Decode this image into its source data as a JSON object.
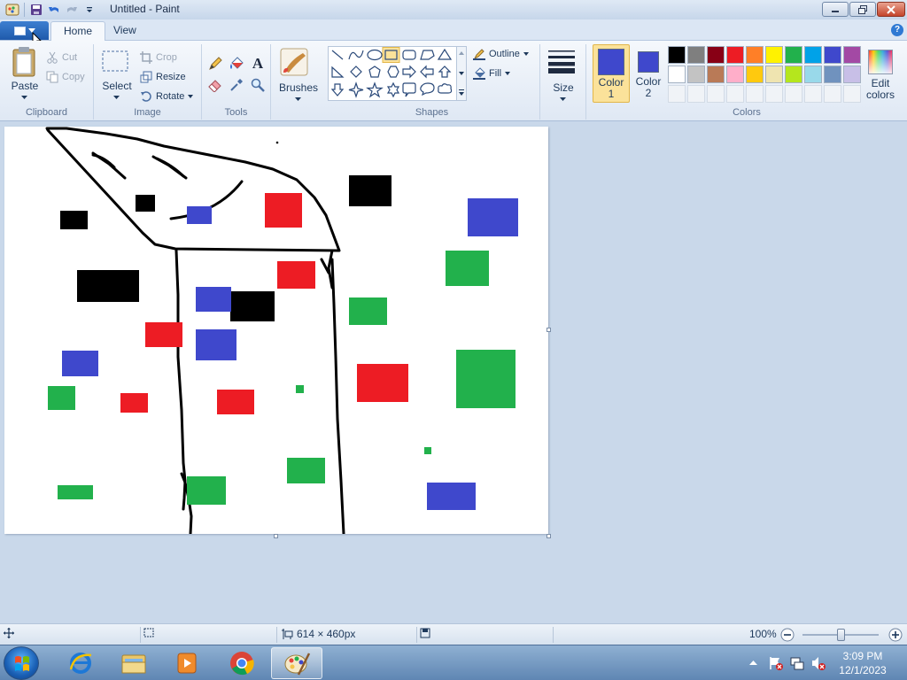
{
  "window": {
    "title": "Untitled - Paint"
  },
  "tabs": [
    {
      "label": "Home"
    },
    {
      "label": "View"
    }
  ],
  "help_glyph": "?",
  "ribbon": {
    "clipboard": {
      "group_label": "Clipboard",
      "paste": "Paste",
      "cut": "Cut",
      "copy": "Copy"
    },
    "image": {
      "group_label": "Image",
      "select": "Select",
      "crop": "Crop",
      "resize": "Resize",
      "rotate": "Rotate"
    },
    "tools": {
      "group_label": "Tools",
      "items": [
        "pencil-icon",
        "fill-bucket-icon",
        "text-icon",
        "eraser-icon",
        "color-picker-icon",
        "magnifier-icon"
      ],
      "text_glyph": "A"
    },
    "brushes": {
      "label": "Brushes"
    },
    "shapes": {
      "group_label": "Shapes",
      "outline": "Outline",
      "fill": "Fill",
      "items": [
        "line",
        "curve",
        "oval",
        "rectangle",
        "rounded-rectangle",
        "polygon",
        "triangle",
        "right-triangle",
        "diamond",
        "pentagon",
        "hexagon",
        "right-arrow",
        "left-arrow",
        "up-arrow",
        "down-arrow",
        "four-point-star",
        "five-point-star",
        "six-point-star",
        "rounded-callout",
        "oval-callout",
        "cloud-callout"
      ],
      "selected": "rectangle"
    },
    "size": {
      "label": "Size"
    },
    "colors": {
      "group_label": "Colors",
      "color1_label_line1": "Color",
      "color1_label_line2": "1",
      "color2_label_line1": "Color",
      "color2_label_line2": "2",
      "color1": "#3f48cc",
      "color2": "#3f48cc",
      "edit_label_line1": "Edit",
      "edit_label_line2": "colors",
      "palette_row1": [
        "#000000",
        "#7f7f7f",
        "#880015",
        "#ed1c24",
        "#ff7f27",
        "#fff200",
        "#22b14c",
        "#00a2e8",
        "#3f48cc",
        "#a349a4"
      ],
      "palette_row2": [
        "#ffffff",
        "#c3c3c3",
        "#b97a57",
        "#ffaec9",
        "#ffc90e",
        "#efe4b0",
        "#b5e61d",
        "#99d9ea",
        "#7092be",
        "#c8bfe7"
      ]
    }
  },
  "canvas_colors": {
    "black": "#000000",
    "red": "#ed1c24",
    "green": "#22b14c",
    "blue": "#3f48cc"
  },
  "statusbar": {
    "image_size": "614 × 460px",
    "zoom": "100%"
  },
  "taskbar": {
    "apps": [
      "internet-explorer",
      "windows-explorer",
      "media-player",
      "chrome",
      "paint"
    ],
    "active_app": "paint",
    "time": "3:09 PM",
    "date": "12/1/2023"
  }
}
